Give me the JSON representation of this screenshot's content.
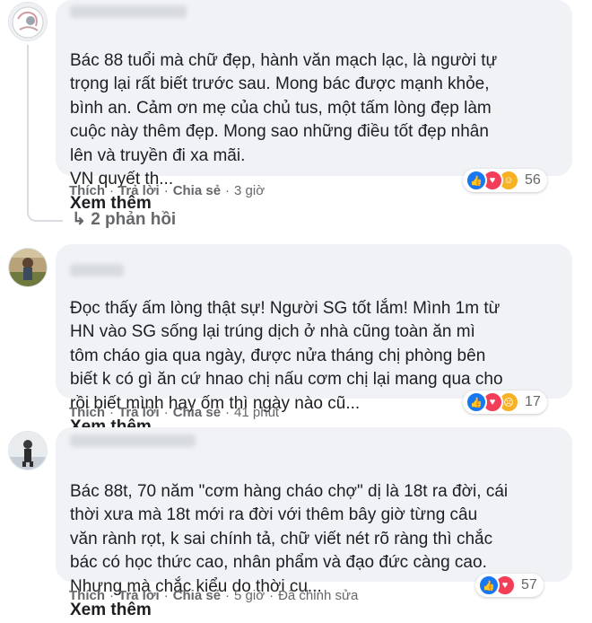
{
  "colors": {
    "bubble": "#f0f2f5",
    "secondary_text": "#65676b",
    "like": "#1877f2",
    "love": "#f33e58",
    "yellow": "#f7b125"
  },
  "see_more_label": "Xem thêm",
  "comments": [
    {
      "text": "Bác 88 tuổi mà chữ đẹp, hành văn mạch lạc, là người tự\ntrọng lại rất biết trước sau. Mong bác được mạnh khỏe,\nbình an. Cảm ơn mẹ của chủ tus, một tấm lòng đẹp làm\ncuộc này thêm đẹp. Mong sao những điều tốt đẹp nhân\nlên và truyền đi xa mãi.\nVN quyết th...",
      "reactions": [
        "like-icon",
        "love-icon",
        "care-icon"
      ],
      "reaction_count": "56",
      "like": "Thích",
      "reply": "Trả lời",
      "share": "Chia sẻ",
      "time": "3 giờ",
      "replies": "2 phản hồi"
    },
    {
      "text": "Đọc thấy ấm lòng thật sự! Người SG tốt lắm! Mình 1m từ\nHN vào SG sống lại trúng dịch ở nhà cũng toàn ăn mì\ntôm cháo gia qua ngày, được nửa tháng chị phòng bên\nbiết k có gì ăn cứ hnao chị nấu cơm chị lại mang qua cho\nrồi biết mình hay ốm thì ngày nào cũ...",
      "reactions": [
        "like-icon",
        "love-icon",
        "sad-icon"
      ],
      "reaction_count": "17",
      "like": "Thích",
      "reply": "Trả lời",
      "share": "Chia sẻ",
      "time": "41 phút"
    },
    {
      "text": "Bác 88t, 70 năm \"cơm hàng cháo chợ\" dị là 18t ra đời, cái\nthời xưa mà 18t mới ra đời với thêm bây giờ từng câu\nvăn rành rọt, k sai chính tả, chữ viết nét rõ ràng thì chắc\nbác có học thức cao, nhân phẩm và đạo đức càng cao.\nNhưng mà chắc kiểu do thời cu...",
      "reactions": [
        "like-icon",
        "love-icon"
      ],
      "reaction_count": "57",
      "like": "Thích",
      "reply": "Trả lời",
      "share": "Chia sẻ",
      "time": "5 giờ",
      "edited": "Đã chỉnh sửa"
    }
  ]
}
